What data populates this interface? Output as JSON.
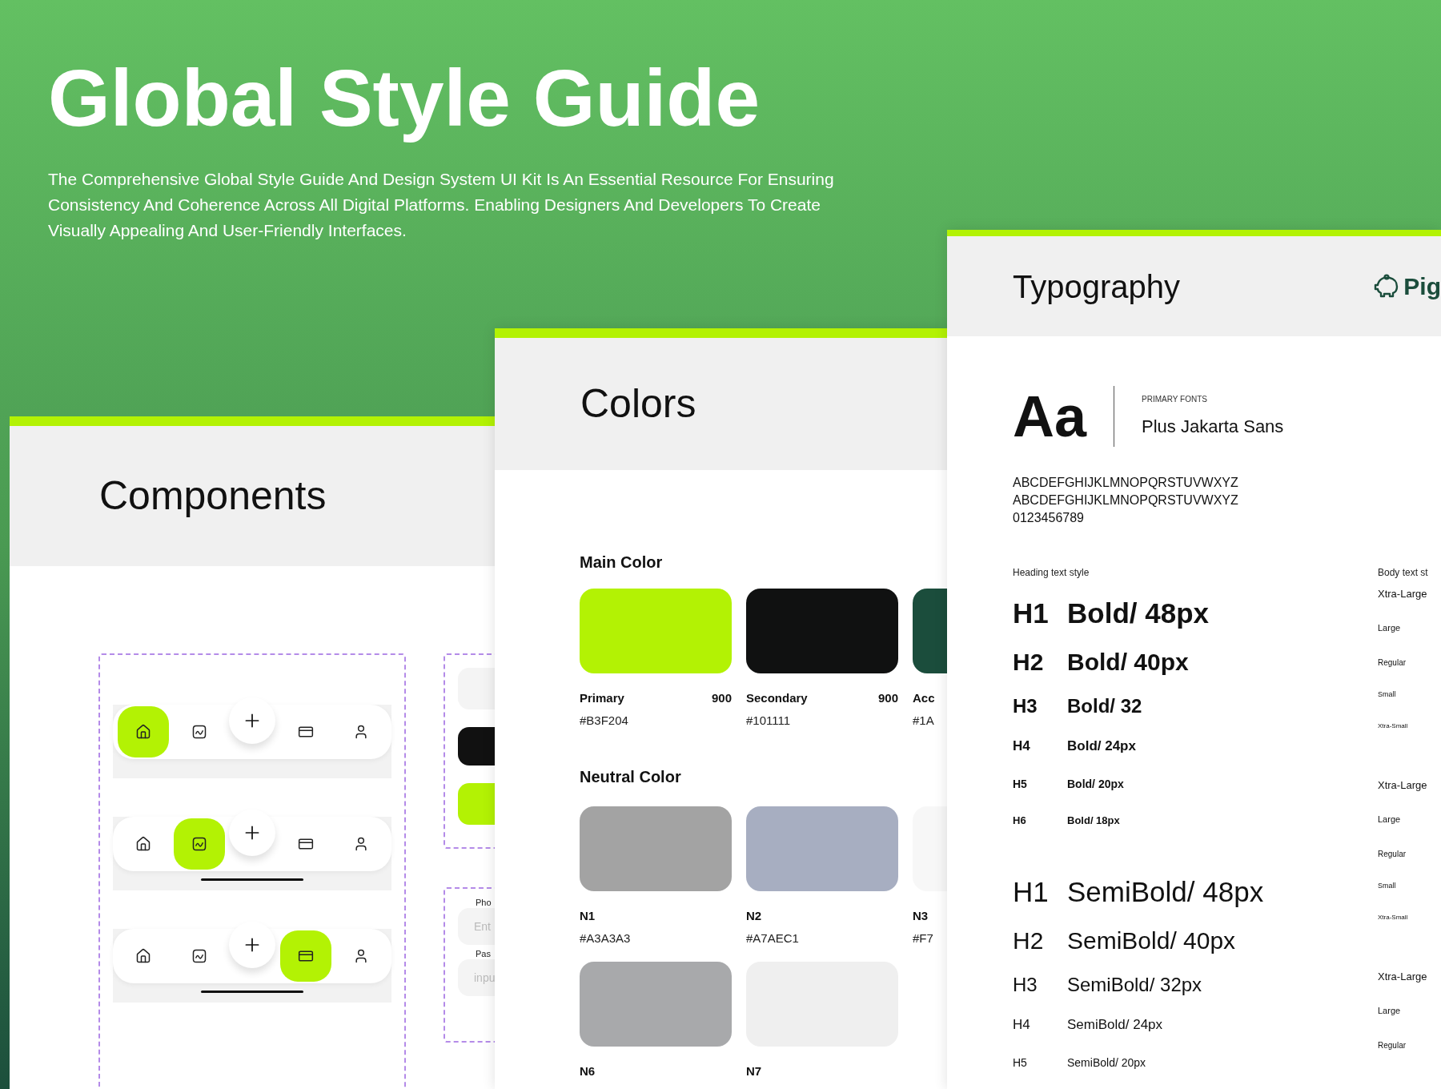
{
  "hero": {
    "title": "Global Style Guide",
    "description": "The Comprehensive Global Style Guide And Design System UI Kit Is An Essential Resource For Ensuring Consistency And Coherence Across All Digital Platforms. Enabling Designers And Developers To Create Visually Appealing And User-Friendly Interfaces."
  },
  "components_panel": {
    "title": "Components",
    "nav_bars": [
      {
        "home_indicator": false,
        "items": [
          {
            "kind": "home",
            "selected": true
          },
          {
            "kind": "chart",
            "selected": false
          },
          {
            "kind": "card",
            "selected": false
          },
          {
            "kind": "user",
            "selected": false
          }
        ]
      },
      {
        "home_indicator": true,
        "items": [
          {
            "kind": "home",
            "selected": false
          },
          {
            "kind": "chart",
            "selected": true
          },
          {
            "kind": "card",
            "selected": false
          },
          {
            "kind": "user",
            "selected": false
          }
        ]
      },
      {
        "home_indicator": true,
        "items": [
          {
            "kind": "home",
            "selected": false
          },
          {
            "kind": "chart",
            "selected": false
          },
          {
            "kind": "card",
            "selected": true
          },
          {
            "kind": "user",
            "selected": false
          }
        ]
      }
    ],
    "button_samples": [
      {
        "kind": "light"
      },
      {
        "kind": "dark"
      },
      {
        "kind": "primary"
      }
    ],
    "form_fields": [
      {
        "label": "Pho",
        "placeholder": "Ent"
      },
      {
        "label": "Pas",
        "placeholder": "inpu"
      }
    ]
  },
  "colors_panel": {
    "title": "Colors",
    "main_title": "Main Color",
    "main_colors": [
      {
        "name": "Primary",
        "shade": "900",
        "hex": "#B3F204",
        "color": "#b3f204"
      },
      {
        "name": "Secondary",
        "shade": "900",
        "hex": "#101111",
        "color": "#101111"
      },
      {
        "name": "Acc",
        "hex": "#1A",
        "color": "#1b4d3c"
      }
    ],
    "neutral_title": "Neutral Color",
    "neutral_colors": [
      {
        "name": "N1",
        "hex": "#A3A3A3",
        "color": "#a3a3a3"
      },
      {
        "name": "N2",
        "hex": "#A7AEC1",
        "color": "#a7aec1"
      },
      {
        "name": "N3",
        "hex": "#F7",
        "color": "#f7f7f7"
      },
      {
        "name": "N6",
        "color": "#a8a9ab"
      },
      {
        "name": "N7",
        "color": "#efefef"
      }
    ]
  },
  "typography_panel": {
    "title": "Typography",
    "brand": "Pig",
    "sample": "Aa",
    "font_caption": "PRIMARY FONTS",
    "font_name": "Plus Jakarta Sans",
    "alphabet": [
      "ABCDEFGHIJKLMNOPQRSTUVWXYZ",
      "ABCDEFGHIJKLMNOPQRSTUVWXYZ",
      "0123456789"
    ],
    "heading_label": "Heading text style",
    "heading_groups": [
      {
        "kind": "bold",
        "rows": [
          {
            "level": "H1",
            "style": "Bold/ 48px"
          },
          {
            "level": "H2",
            "style": "Bold/ 40px"
          },
          {
            "level": "H3",
            "style": "Bold/ 32"
          },
          {
            "level": "H4",
            "style": "Bold/ 24px"
          },
          {
            "level": "H5",
            "style": "Bold/ 20px"
          },
          {
            "level": "H6",
            "style": "Bold/ 18px"
          }
        ]
      },
      {
        "kind": "semibold",
        "rows": [
          {
            "level": "H1",
            "style": "SemiBold/ 48px"
          },
          {
            "level": "H2",
            "style": "SemiBold/ 40px"
          },
          {
            "level": "H3",
            "style": "SemiBold/ 32px"
          },
          {
            "level": "H4",
            "style": "SemiBold/ 24px"
          },
          {
            "level": "H5",
            "style": "SemiBold/ 20px"
          }
        ]
      }
    ],
    "body_label": "Body text st",
    "body_groups": [
      [
        "Xtra-Large",
        "Large",
        "Regular",
        "Small",
        "Xtra-Small"
      ],
      [
        "Xtra-Large",
        "Large",
        "Regular",
        "Small",
        "Xtra-Small"
      ],
      [
        "Xtra-Large",
        "Large",
        "Regular"
      ]
    ]
  }
}
